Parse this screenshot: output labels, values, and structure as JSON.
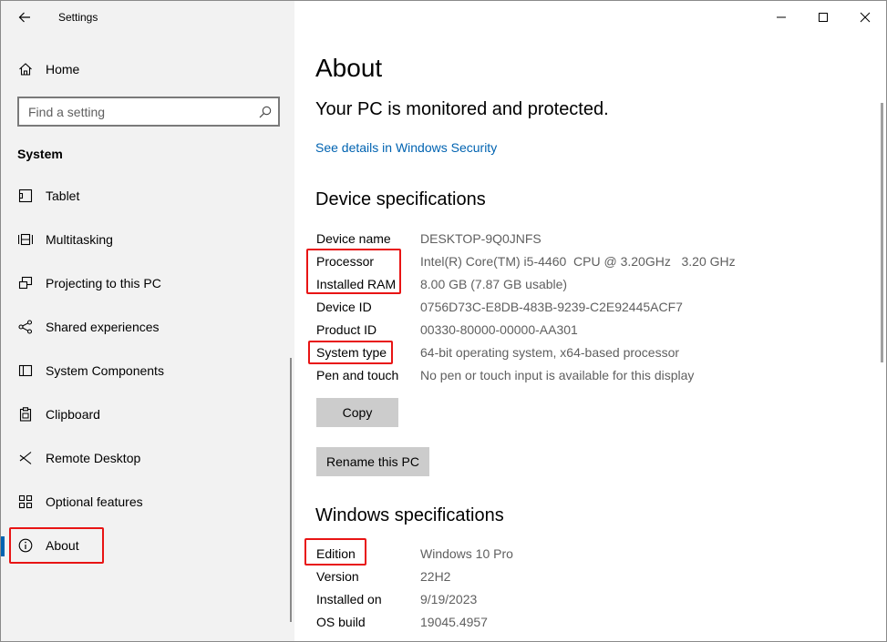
{
  "app": {
    "title": "Settings"
  },
  "sidebar": {
    "home_label": "Home",
    "search_placeholder": "Find a setting",
    "section_title": "System",
    "items": [
      {
        "label": "Tablet",
        "icon": "tablet-icon"
      },
      {
        "label": "Multitasking",
        "icon": "multitasking-icon"
      },
      {
        "label": "Projecting to this PC",
        "icon": "projecting-icon"
      },
      {
        "label": "Shared experiences",
        "icon": "shared-experiences-icon"
      },
      {
        "label": "System Components",
        "icon": "system-components-icon"
      },
      {
        "label": "Clipboard",
        "icon": "clipboard-icon"
      },
      {
        "label": "Remote Desktop",
        "icon": "remote-desktop-icon"
      },
      {
        "label": "Optional features",
        "icon": "optional-features-icon"
      },
      {
        "label": "About",
        "icon": "info-icon",
        "active": true
      }
    ]
  },
  "main": {
    "title": "About",
    "protection_text": "Your PC is monitored and protected.",
    "security_link": "See details in Windows Security",
    "device_specs": {
      "heading": "Device specifications",
      "rows": [
        {
          "label": "Device name",
          "value": "DESKTOP-9Q0JNFS"
        },
        {
          "label": "Processor",
          "value": "Intel(R) Core(TM) i5-4460  CPU @ 3.20GHz   3.20 GHz"
        },
        {
          "label": "Installed RAM",
          "value": "8.00 GB (7.87 GB usable)"
        },
        {
          "label": "Device ID",
          "value": "0756D73C-E8DB-483B-9239-C2E92445ACF7"
        },
        {
          "label": "Product ID",
          "value": "00330-80000-00000-AA301"
        },
        {
          "label": "System type",
          "value": "64-bit operating system, x64-based processor"
        },
        {
          "label": "Pen and touch",
          "value": "No pen or touch input is available for this display"
        }
      ],
      "copy_button": "Copy",
      "rename_button": "Rename this PC"
    },
    "windows_specs": {
      "heading": "Windows specifications",
      "rows": [
        {
          "label": "Edition",
          "value": "Windows 10 Pro"
        },
        {
          "label": "Version",
          "value": "22H2"
        },
        {
          "label": "Installed on",
          "value": "9/19/2023"
        },
        {
          "label": "OS build",
          "value": "19045.4957"
        }
      ]
    }
  },
  "colors": {
    "accent": "#0063b1",
    "sidebar_bg": "#f2f2f2",
    "highlight": "#e81414",
    "button_bg": "#cccccc"
  }
}
